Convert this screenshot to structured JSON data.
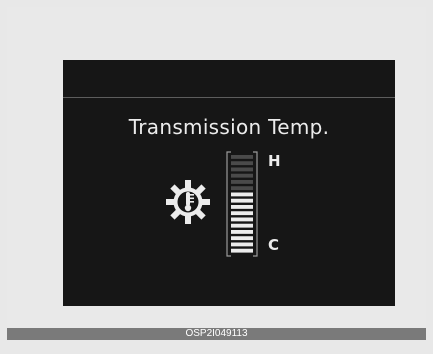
{
  "display": {
    "title": "Transmission Temp.",
    "icon": "transmission-temperature-icon",
    "gauge": {
      "high_label": "H",
      "low_label": "C",
      "total_segments": 16,
      "lit_segments": 10,
      "level_fraction": 0.625
    }
  },
  "caption": "OSP2I049113",
  "colors": {
    "screen_background": "#161616",
    "text": "#ececec",
    "page_background": "#e9e9e9",
    "caption_bar": "#7a7a7a"
  }
}
